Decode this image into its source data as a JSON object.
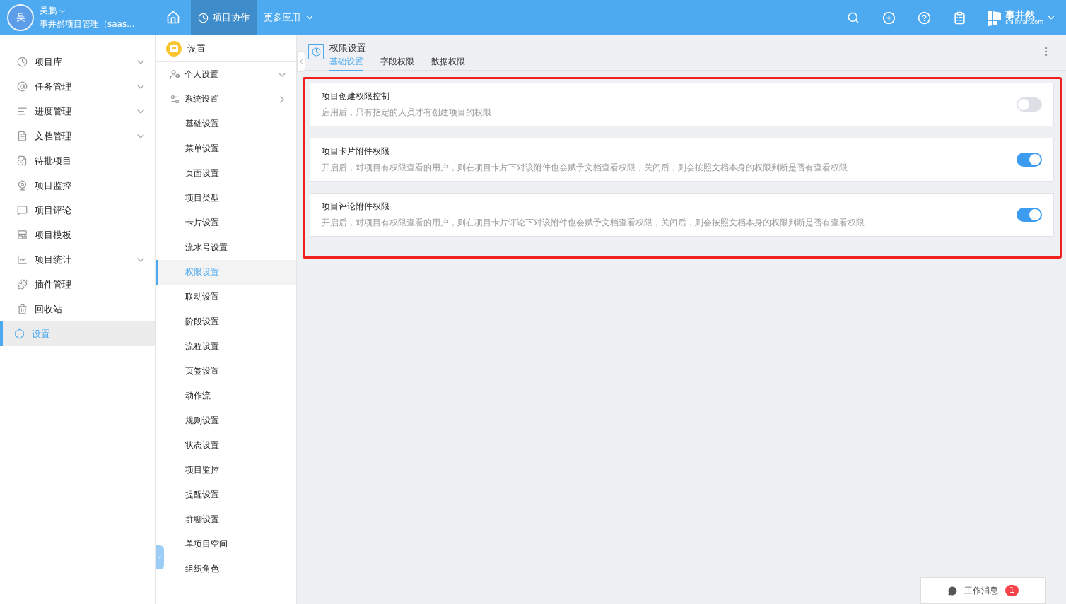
{
  "header": {
    "user": {
      "avatar": "吴",
      "name": "吴鹏",
      "org": "事井然项目管理（saas..."
    },
    "nav": [
      {
        "label": "项目协作",
        "selected": true,
        "kind": "app"
      },
      {
        "label": "更多应用",
        "selected": false,
        "kind": "menu"
      }
    ],
    "logo": {
      "name": "事井然",
      "domain": "shijinran.com"
    }
  },
  "sidebar": {
    "items": [
      {
        "label": "项目库",
        "expandable": true,
        "selected": false
      },
      {
        "label": "任务管理",
        "expandable": true,
        "selected": false
      },
      {
        "label": "进度管理",
        "expandable": true,
        "selected": false
      },
      {
        "label": "文档管理",
        "expandable": true,
        "selected": false
      },
      {
        "label": "待批项目",
        "expandable": false,
        "selected": false
      },
      {
        "label": "项目监控",
        "expandable": false,
        "selected": false
      },
      {
        "label": "项目评论",
        "expandable": false,
        "selected": false
      },
      {
        "label": "项目模板",
        "expandable": false,
        "selected": false
      },
      {
        "label": "项目统计",
        "expandable": true,
        "selected": false
      },
      {
        "label": "插件管理",
        "expandable": false,
        "selected": false
      },
      {
        "label": "回收站",
        "expandable": false,
        "selected": false
      },
      {
        "label": "设置",
        "expandable": false,
        "selected": true
      }
    ]
  },
  "settings_menu": {
    "title": "设置",
    "groups": [
      {
        "label": "个人设置",
        "expanded": false
      },
      {
        "label": "系统设置",
        "expanded": true,
        "children": [
          {
            "label": "基础设置",
            "selected": false
          },
          {
            "label": "菜单设置",
            "selected": false
          },
          {
            "label": "页面设置",
            "selected": false
          },
          {
            "label": "项目类型",
            "selected": false
          },
          {
            "label": "卡片设置",
            "selected": false
          },
          {
            "label": "流水号设置",
            "selected": false
          },
          {
            "label": "权限设置",
            "selected": true
          },
          {
            "label": "联动设置",
            "selected": false
          },
          {
            "label": "阶段设置",
            "selected": false
          },
          {
            "label": "流程设置",
            "selected": false
          },
          {
            "label": "页签设置",
            "selected": false
          },
          {
            "label": "动作流",
            "selected": false
          },
          {
            "label": "规则设置",
            "selected": false
          },
          {
            "label": "状态设置",
            "selected": false
          },
          {
            "label": "项目监控",
            "selected": false
          },
          {
            "label": "提醒设置",
            "selected": false
          },
          {
            "label": "群聊设置",
            "selected": false
          },
          {
            "label": "单项目空间",
            "selected": false
          },
          {
            "label": "组织角色",
            "selected": false
          }
        ]
      }
    ]
  },
  "page": {
    "title": "权限设置",
    "tabs": [
      {
        "label": "基础设置",
        "selected": true
      },
      {
        "label": "字段权限",
        "selected": false
      },
      {
        "label": "数据权限",
        "selected": false
      }
    ],
    "settings": [
      {
        "title": "项目创建权限控制",
        "description": "启用后，只有指定的人员才有创建项目的权限",
        "on": false
      },
      {
        "title": "项目卡片附件权限",
        "description": "开启后，对项目有权限查看的用户，则在项目卡片下对该附件也会赋予文档查看权限，关闭后，则会按照文档本身的权限判断是否有查看权限",
        "on": true
      },
      {
        "title": "项目评论附件权限",
        "description": "开启后，对项目有权限查看的用户，则在项目卡片评论下对该附件也会赋予文档查看权限，关闭后，则会按照文档本身的权限判断是否有查看权限",
        "on": true
      }
    ]
  },
  "messages": {
    "label": "工作消息",
    "count": "1"
  }
}
